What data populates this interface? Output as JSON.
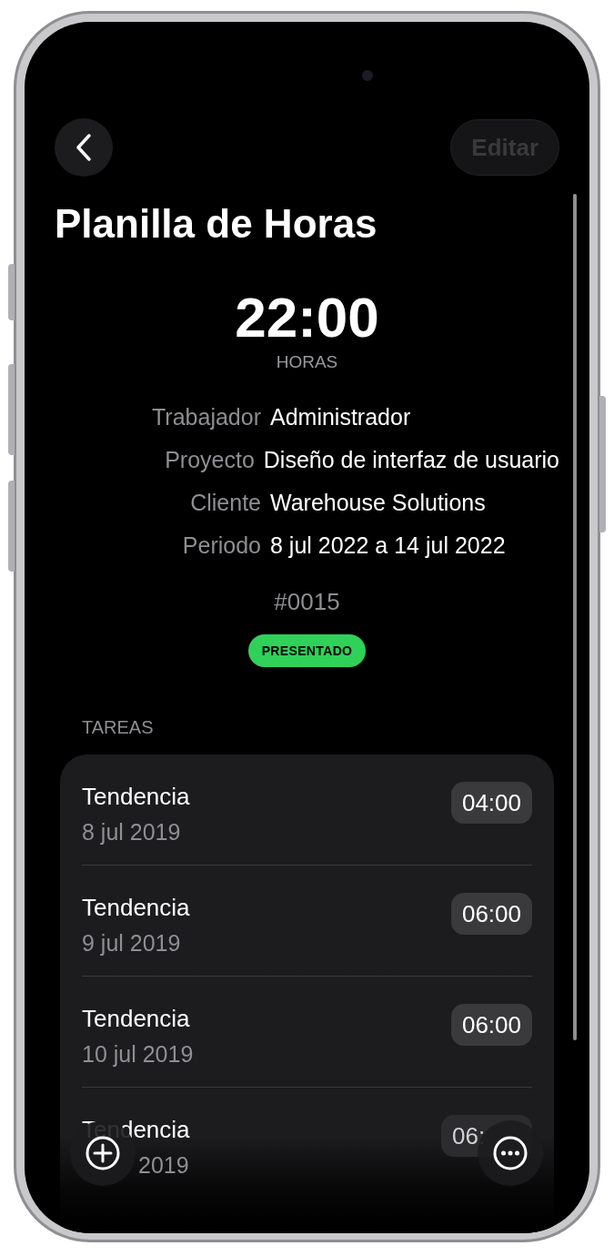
{
  "edit_button": {
    "label": "Editar",
    "disabled": true
  },
  "title": "Planilla de Horas",
  "total": {
    "value": "22:00",
    "unit": "HORAS"
  },
  "details": [
    {
      "label": "Trabajador",
      "value": "Administrador"
    },
    {
      "label": "Proyecto",
      "value": "Diseño de interfaz de usuario"
    },
    {
      "label": "Cliente",
      "value": "Warehouse Solutions"
    },
    {
      "label": "Periodo",
      "value": "8 jul 2022 a 14 jul 2022"
    }
  ],
  "number": "#0015",
  "status": "PRESENTADO",
  "tasks": {
    "header": "TAREAS",
    "items": [
      {
        "title": "Tendencia",
        "date": "8 jul 2019",
        "hours": "04:00"
      },
      {
        "title": "Tendencia",
        "date": "9 jul 2019",
        "hours": "06:00"
      },
      {
        "title": "Tendencia",
        "date": "10 jul 2019",
        "hours": "06:00"
      },
      {
        "kind": "partly_hidden",
        "title": "Tendencia",
        "date": "2019",
        "hours": "06:"
      }
    ]
  }
}
